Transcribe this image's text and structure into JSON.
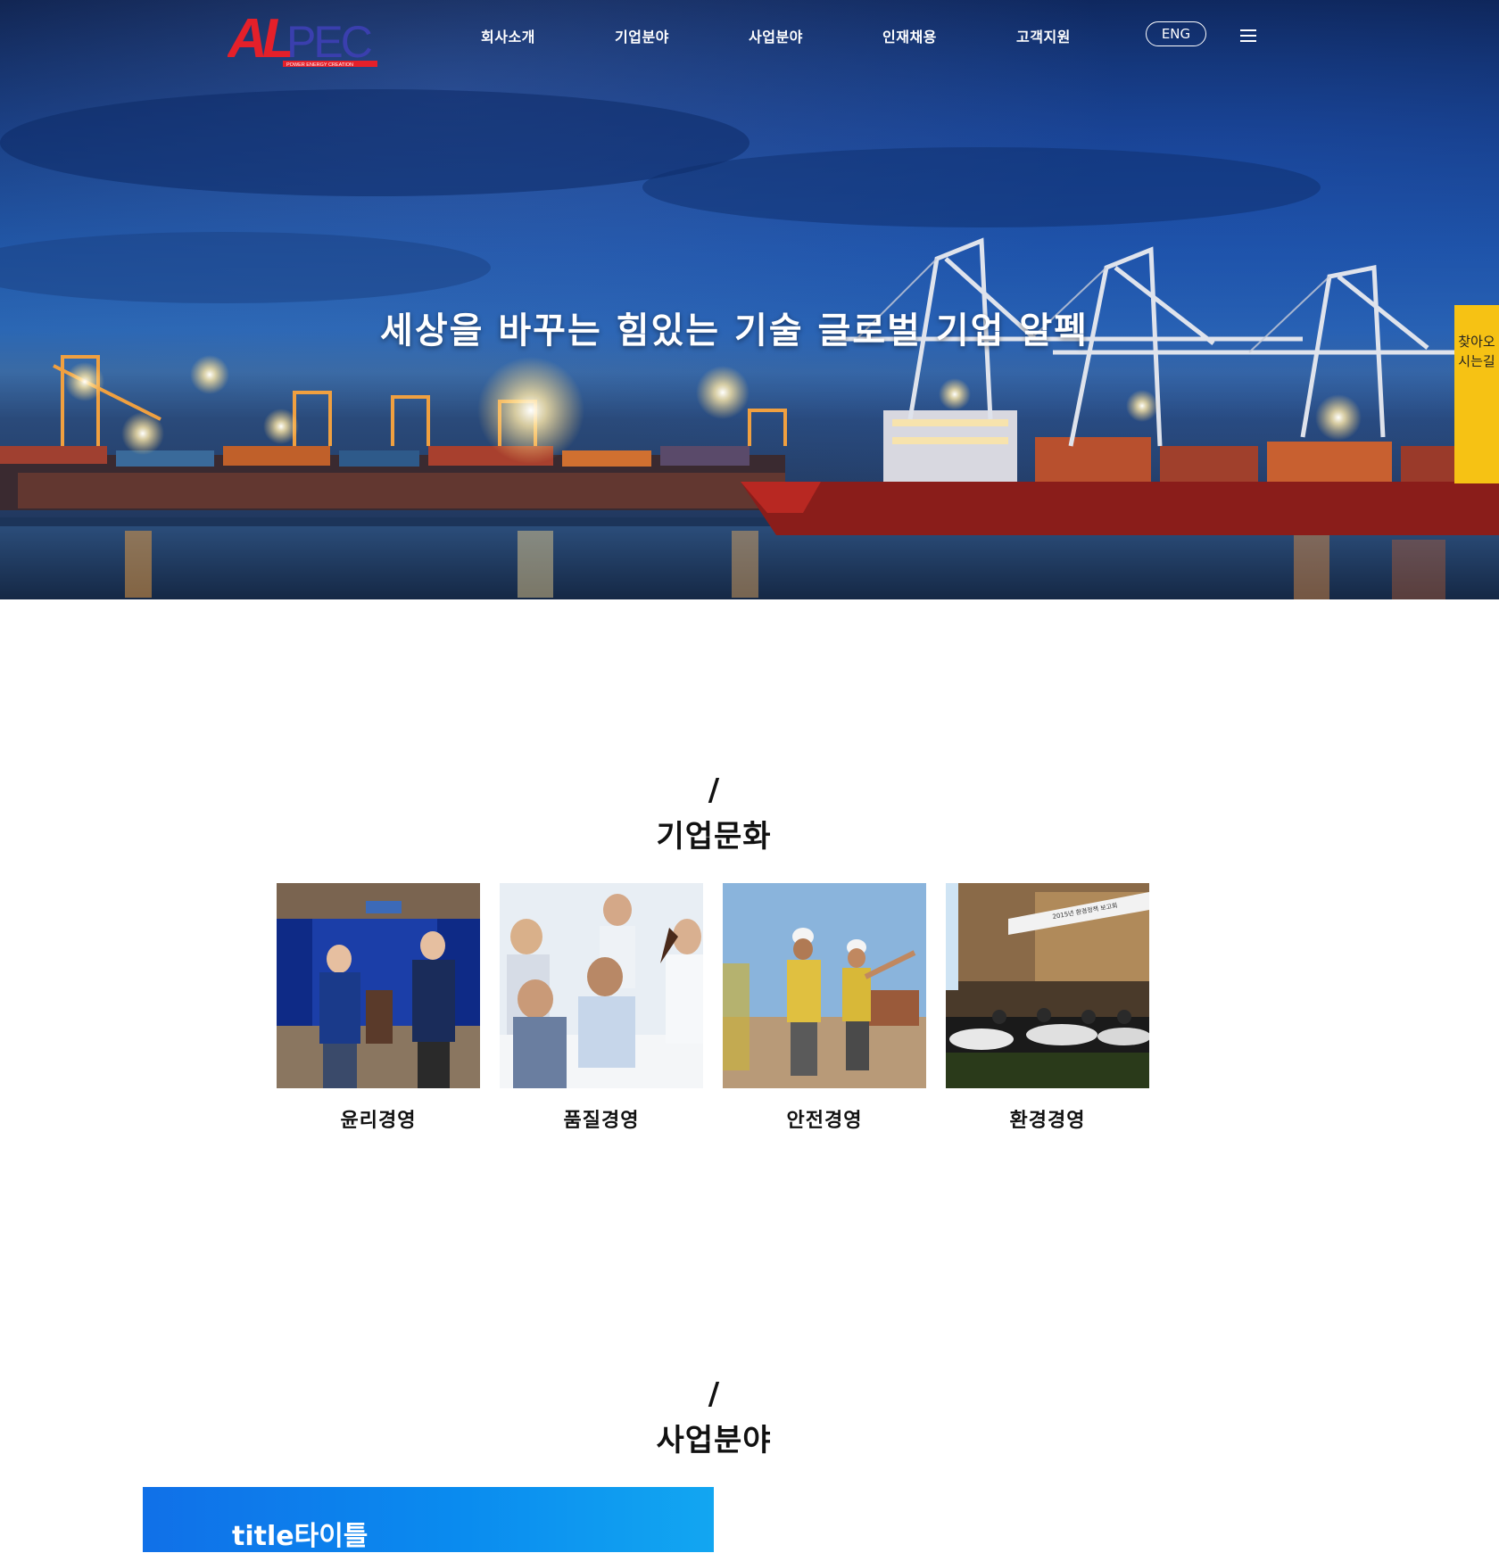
{
  "header": {
    "logo_text": "ALPEC",
    "logo_tagline": "POWER ENERGY CREATION",
    "nav": [
      "회사소개",
      "기업분야",
      "사업분야",
      "인재채용",
      "고객지원"
    ],
    "lang_button": "ENG"
  },
  "hero": {
    "title": "세상을 바꾸는 힘있는 기술 글로벌 기업 알펙"
  },
  "side_tab": {
    "label": "찾아오시는길"
  },
  "culture": {
    "slash": "/",
    "title": "기업문화",
    "cards": [
      {
        "label": "윤리경영"
      },
      {
        "label": "품질경영"
      },
      {
        "label": "안전경영"
      },
      {
        "label": "환경경영"
      }
    ],
    "card4_banner_text": "2015년 환경정책 보고회"
  },
  "business": {
    "slash": "/",
    "title": "사업분야",
    "box_title": "title타이틀"
  },
  "colors": {
    "logo_red": "#e4202a",
    "logo_blue": "#2c3592",
    "side_tab": "#f6c214",
    "biz_blue": "#1070e8"
  }
}
